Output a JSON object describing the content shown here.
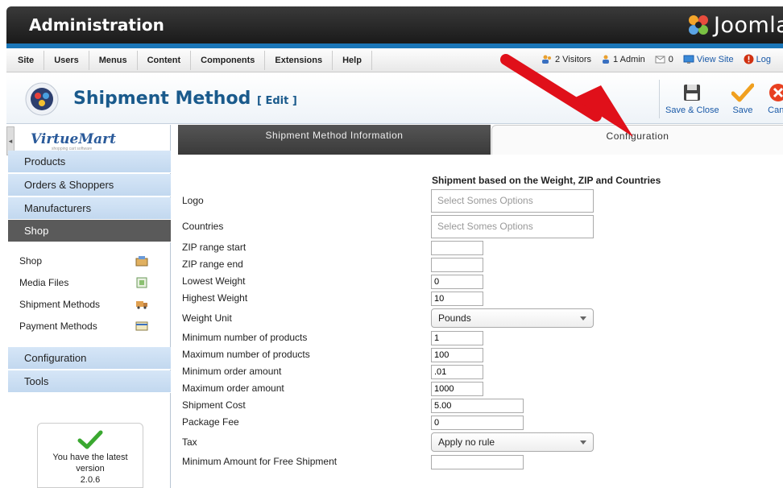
{
  "app": {
    "title": "Administration",
    "brand": "Joomla"
  },
  "menu": {
    "items": [
      "Site",
      "Users",
      "Menus",
      "Content",
      "Components",
      "Extensions",
      "Help"
    ]
  },
  "status": {
    "visitors": "2 Visitors",
    "admins": "1 Admin",
    "messages": "0",
    "view_site": "View Site",
    "logout": "Log"
  },
  "header": {
    "page_title": "Shipment Method",
    "edit_tag": "[ Edit ]"
  },
  "toolbar": {
    "save_close": "Save & Close",
    "save": "Save",
    "cancel": "Canc"
  },
  "sidebar": {
    "logo": "VirtueMart",
    "tagline": "shopping cart software",
    "collapse_glyph": "◂",
    "main_items": [
      "Products",
      "Orders & Shoppers",
      "Manufacturers",
      "Shop"
    ],
    "sub_items": [
      "Shop",
      "Media Files",
      "Shipment Methods",
      "Payment Methods"
    ],
    "bottom_items": [
      "Configuration",
      "Tools"
    ],
    "version_text": "You have the latest version",
    "version": "2.0.6"
  },
  "tabs": {
    "info": "Shipment Method Information",
    "config": "Configuration"
  },
  "form": {
    "heading": "Shipment based on the Weight, ZIP and Countries",
    "logo_label": "Logo",
    "logo_placeholder": "Select Somes Options",
    "countries_label": "Countries",
    "countries_placeholder": "Select Somes Options",
    "zip_start_label": "ZIP range start",
    "zip_start_value": "",
    "zip_end_label": "ZIP range end",
    "zip_end_value": "",
    "lowest_weight_label": "Lowest Weight",
    "lowest_weight_value": "0",
    "highest_weight_label": "Highest Weight",
    "highest_weight_value": "10",
    "weight_unit_label": "Weight Unit",
    "weight_unit_value": "Pounds",
    "min_products_label": "Minimum number of products",
    "min_products_value": "1",
    "max_products_label": "Maximum number of products",
    "max_products_value": "100",
    "min_order_label": "Minimum order amount",
    "min_order_value": ".01",
    "max_order_label": "Maximum order amount",
    "max_order_value": "1000",
    "shipment_cost_label": "Shipment Cost",
    "shipment_cost_value": "5.00",
    "package_fee_label": "Package Fee",
    "package_fee_value": "0",
    "tax_label": "Tax",
    "tax_value": "Apply no rule",
    "free_shipment_label": "Minimum Amount for Free Shipment",
    "free_shipment_value": ""
  },
  "colors": {
    "annotation_arrow": "#e0101a",
    "title_blue": "#1a5a8c",
    "sidebar_blue": "#c8dcf1",
    "active_dark": "#5a5a5a"
  }
}
